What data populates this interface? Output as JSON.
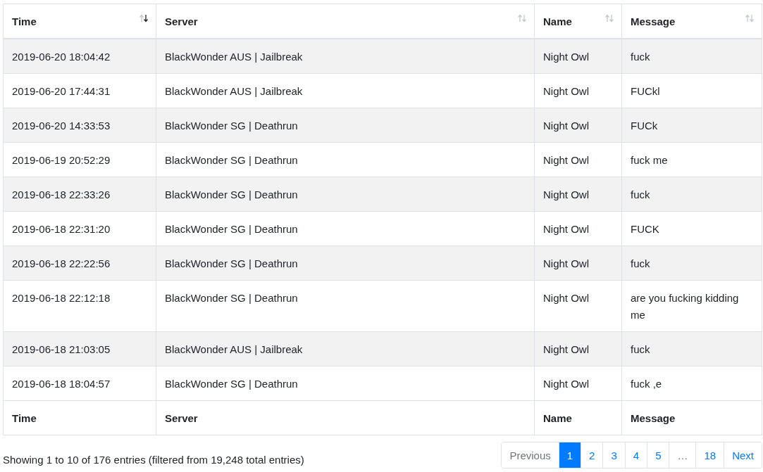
{
  "table": {
    "columns": [
      {
        "label": "Time",
        "sorted": true
      },
      {
        "label": "Server",
        "sorted": false
      },
      {
        "label": "Name",
        "sorted": false
      },
      {
        "label": "Message",
        "sorted": false
      }
    ],
    "rows": [
      [
        "2019-06-20 18:04:42",
        "BlackWonder AUS | Jailbreak",
        "Night Owl",
        "fuck"
      ],
      [
        "2019-06-20 17:44:31",
        "BlackWonder AUS | Jailbreak",
        "Night Owl",
        "FUCkl"
      ],
      [
        "2019-06-20 14:33:53",
        "BlackWonder SG | Deathrun",
        "Night Owl",
        "FUCk"
      ],
      [
        "2019-06-19 20:52:29",
        "BlackWonder SG | Deathrun",
        "Night Owl",
        "fuck me"
      ],
      [
        "2019-06-18 22:33:26",
        "BlackWonder SG | Deathrun",
        "Night Owl",
        "fuck"
      ],
      [
        "2019-06-18 22:31:20",
        "BlackWonder SG | Deathrun",
        "Night Owl",
        "FUCK"
      ],
      [
        "2019-06-18 22:22:56",
        "BlackWonder SG | Deathrun",
        "Night Owl",
        "fuck"
      ],
      [
        "2019-06-18 22:12:18",
        "BlackWonder SG | Deathrun",
        "Night Owl",
        "are you fucking kidding me"
      ],
      [
        "2019-06-18 21:03:05",
        "BlackWonder AUS | Jailbreak",
        "Night Owl",
        "fuck"
      ],
      [
        "2019-06-18 18:04:57",
        "BlackWonder SG | Deathrun",
        "Night Owl",
        "fuck ,e"
      ]
    ],
    "footer": [
      "Time",
      "Server",
      "Name",
      "Message"
    ]
  },
  "info": "Showing 1 to 10 of 176 entries (filtered from 19,248 total entries)",
  "pagination": [
    {
      "label": "Previous",
      "selected": false,
      "disabled": true
    },
    {
      "label": "1",
      "selected": true,
      "disabled": false
    },
    {
      "label": "2",
      "selected": false,
      "disabled": false
    },
    {
      "label": "3",
      "selected": false,
      "disabled": false
    },
    {
      "label": "4",
      "selected": false,
      "disabled": false
    },
    {
      "label": "5",
      "selected": false,
      "disabled": false
    },
    {
      "label": "…",
      "selected": false,
      "disabled": true
    },
    {
      "label": "18",
      "selected": false,
      "disabled": false
    },
    {
      "label": "Next",
      "selected": false,
      "disabled": false
    }
  ]
}
